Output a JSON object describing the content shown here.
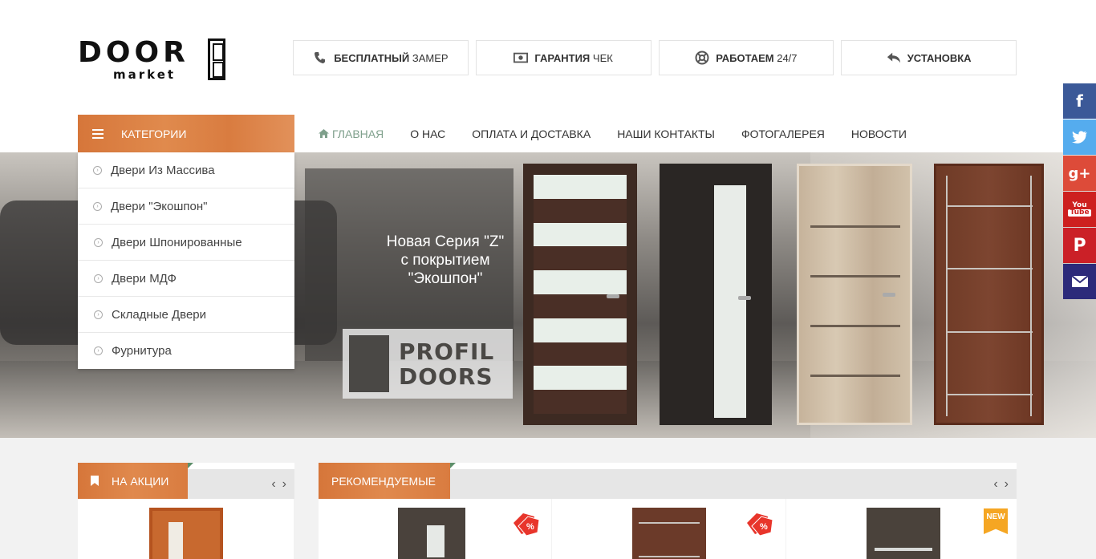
{
  "logo": {
    "word": "DOOR",
    "sub": "market"
  },
  "features": [
    {
      "icon": "phone-icon",
      "bold": "БЕСПЛАТНЫЙ",
      "rest": "ЗАМЕР"
    },
    {
      "icon": "money-icon",
      "bold": "ГАРАНТИЯ",
      "rest": "ЧЕК"
    },
    {
      "icon": "lifebuoy-icon",
      "bold": "РАБОТАЕМ",
      "rest": "24/7"
    },
    {
      "icon": "reply-icon",
      "bold": "УСТАНОВКА",
      "rest": ""
    }
  ],
  "categories": {
    "title": "КАТЕГОРИИ",
    "items": [
      "Двери Из Массива",
      "Двери \"Экошпон\"",
      "Двери Шпонированные",
      "Двери МДФ",
      "Складные Двери",
      "Фурнитура"
    ]
  },
  "nav": {
    "home": "ГЛАВНАЯ",
    "items": [
      "О НАС",
      "ОПЛАТА И ДОСТАВКА",
      "НАШИ КОНТАКТЫ",
      "ФОТОГАЛЕРЕЯ",
      "НОВОСТИ"
    ]
  },
  "banner": {
    "line1": "Новая Серия \"Z\"",
    "line2": "с покрытием",
    "line3": "\"Экошпон\"",
    "brand1": "PROFIL",
    "brand2": "DOORS"
  },
  "sections": {
    "sale": "НА АКЦИИ",
    "recommended": "РЕКОМЕНДУЕМЫЕ",
    "new_badge": "NEW"
  },
  "colors": {
    "accent": "#d97c40",
    "nav_home": "#7fa08c",
    "facebook": "#3b5998",
    "twitter": "#55acee",
    "google": "#dd4b39",
    "youtube": "#cd201f",
    "pinterest": "#cb2027",
    "email": "#2c2a7a"
  },
  "social": [
    "facebook-icon",
    "twitter-icon",
    "google-plus-icon",
    "youtube-icon",
    "pinterest-icon",
    "email-icon"
  ]
}
